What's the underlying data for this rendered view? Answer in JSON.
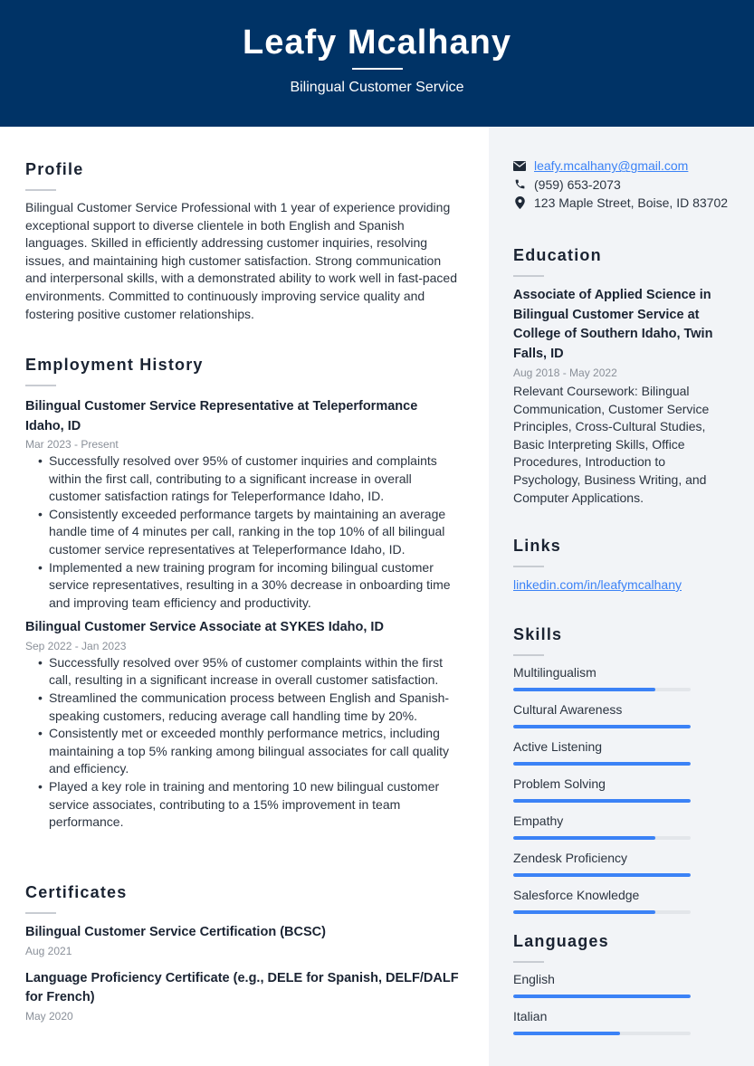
{
  "header": {
    "name": "Leafy Mcalhany",
    "title": "Bilingual Customer Service"
  },
  "profile": {
    "heading": "Profile",
    "text": "Bilingual Customer Service Professional with 1 year of experience providing exceptional support to diverse clientele in both English and Spanish languages. Skilled in efficiently addressing customer inquiries, resolving issues, and maintaining high customer satisfaction. Strong communication and interpersonal skills, with a demonstrated ability to work well in fast-paced environments. Committed to continuously improving service quality and fostering positive customer relationships."
  },
  "employment": {
    "heading": "Employment History",
    "jobs": [
      {
        "title": "Bilingual Customer Service Representative at Teleperformance Idaho, ID",
        "date": "Mar 2023 - Present",
        "bullets": [
          "Successfully resolved over 95% of customer inquiries and complaints within the first call, contributing to a significant increase in overall customer satisfaction ratings for Teleperformance Idaho, ID.",
          "Consistently exceeded performance targets by maintaining an average handle time of 4 minutes per call, ranking in the top 10% of all bilingual customer service representatives at Teleperformance Idaho, ID.",
          "Implemented a new training program for incoming bilingual customer service representatives, resulting in a 30% decrease in onboarding time and improving team efficiency and productivity."
        ]
      },
      {
        "title": "Bilingual Customer Service Associate at SYKES Idaho, ID",
        "date": "Sep 2022 - Jan 2023",
        "bullets": [
          "Successfully resolved over 95% of customer complaints within the first call, resulting in a significant increase in overall customer satisfaction.",
          "Streamlined the communication process between English and Spanish-speaking customers, reducing average call handling time by 20%.",
          "Consistently met or exceeded monthly performance metrics, including maintaining a top 5% ranking among bilingual associates for call quality and efficiency.",
          "Played a key role in training and mentoring 10 new bilingual customer service associates, contributing to a 15% improvement in team performance."
        ]
      }
    ]
  },
  "certificates": {
    "heading": "Certificates",
    "items": [
      {
        "title": "Bilingual Customer Service Certification (BCSC)",
        "date": "Aug 2021"
      },
      {
        "title": "Language Proficiency Certificate (e.g., DELE for Spanish, DELF/DALF for French)",
        "date": "May 2020"
      }
    ]
  },
  "contact": {
    "email": "leafy.mcalhany@gmail.com",
    "phone": "(959) 653-2073",
    "address": "123 Maple Street, Boise, ID 83702",
    "icons": [
      "envelope-icon",
      "phone-icon",
      "map-pin-icon"
    ]
  },
  "education": {
    "heading": "Education",
    "title": "Associate of Applied Science in Bilingual Customer Service at College of Southern Idaho, Twin Falls, ID",
    "date": "Aug 2018 - May 2022",
    "text": "Relevant Coursework: Bilingual Communication, Customer Service Principles, Cross-Cultural Studies, Basic Interpreting Skills, Office Procedures, Introduction to Psychology, Business Writing, and Computer Applications."
  },
  "links": {
    "heading": "Links",
    "items": [
      "linkedin.com/in/leafymcalhany"
    ]
  },
  "skills": {
    "heading": "Skills",
    "items": [
      {
        "name": "Multilingualism",
        "level": 0.8
      },
      {
        "name": "Cultural Awareness",
        "level": 1.0
      },
      {
        "name": "Active Listening",
        "level": 1.0
      },
      {
        "name": "Problem Solving",
        "level": 1.0
      },
      {
        "name": "Empathy",
        "level": 0.8
      },
      {
        "name": "Zendesk Proficiency",
        "level": 1.0
      },
      {
        "name": "Salesforce Knowledge",
        "level": 0.8
      }
    ]
  },
  "languages": {
    "heading": "Languages",
    "items": [
      {
        "name": "English",
        "level": 1.0
      },
      {
        "name": "Italian",
        "level": 0.6
      }
    ]
  },
  "colors": {
    "header_bg": "#003366",
    "sidebar_bg": "#f2f4f7",
    "accent": "#3b82f6"
  }
}
